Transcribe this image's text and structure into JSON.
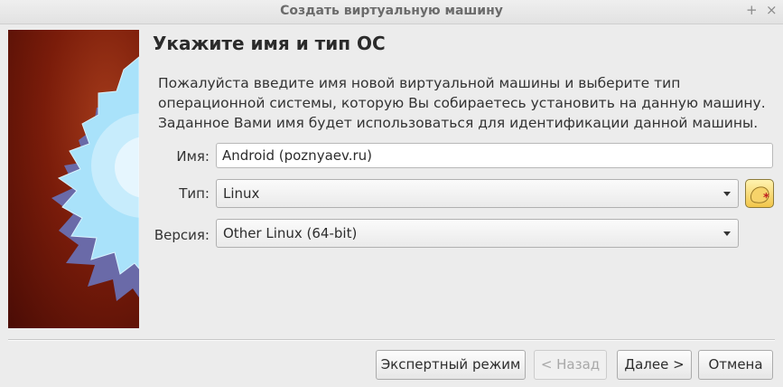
{
  "window": {
    "title": "Создать виртуальную машину",
    "extra_button": "+",
    "close_button": "×"
  },
  "page": {
    "heading": "Укажите имя и тип ОС",
    "description": "Пожалуйста введите имя новой виртуальной машины и выберите тип операционной системы, которую Вы собираетесь установить на данную машину. Заданное Вами имя будет использоваться для идентификации данной машины."
  },
  "form": {
    "name_label": "Имя:",
    "name_value": "Android (poznyaev.ru)",
    "type_label": "Тип:",
    "type_value": "Linux",
    "version_label": "Версия:",
    "version_value": "Other Linux (64-bit)"
  },
  "buttons": {
    "expert": "Экспертный режим",
    "back": "< Назад",
    "next": "Далее >",
    "cancel": "Отмена"
  },
  "colors": {
    "banner": "#7a1c0a",
    "star": "#9fdcf7"
  }
}
